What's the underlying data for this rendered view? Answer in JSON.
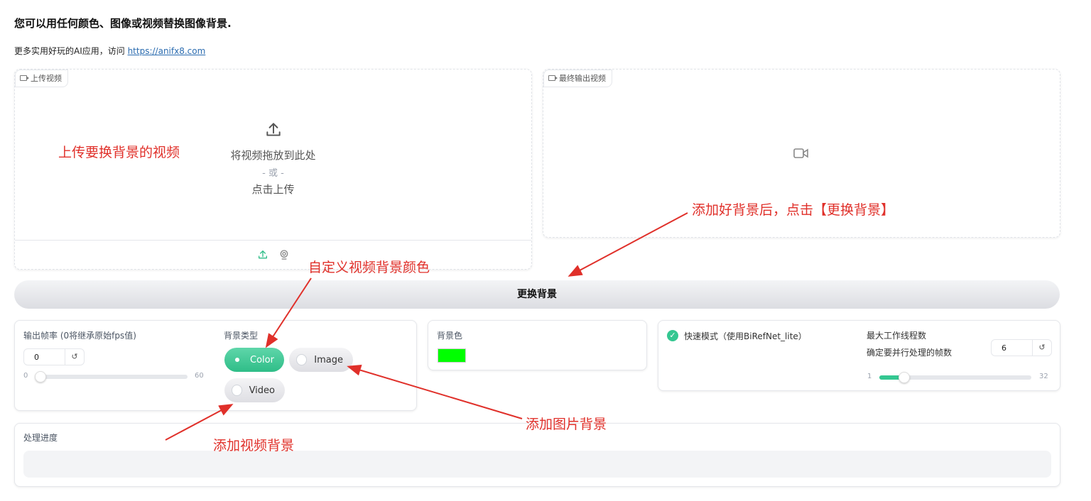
{
  "header": {
    "subtitle": "您可以用任何颜色、图像或视频替换图像背景.",
    "note_prefix": "更多实用好玩的AI应用，访问 ",
    "note_link": "https://anifx8.com"
  },
  "upload_panel": {
    "tag": "上传视频",
    "drop_text": "将视频拖放到此处",
    "or_text": "- 或 -",
    "click_text": "点击上传"
  },
  "output_panel": {
    "tag": "最终输出视频"
  },
  "action_button": "更换背景",
  "fps": {
    "label": "输出帧率 (0将继承原始fps值)",
    "value": "0",
    "reset": "↺",
    "min": "0",
    "max": "60",
    "level": 0
  },
  "bg_type": {
    "label": "背景类型",
    "options": [
      "Color",
      "Image",
      "Video"
    ],
    "selected": "Color"
  },
  "bg_color": {
    "label": "背景色",
    "value": "#00ff00"
  },
  "fast_mode": {
    "label": "快速模式（使用BiRefNet_lite）",
    "checked": true
  },
  "workers": {
    "label": "最大工作线程数",
    "desc": "确定要并行处理的帧数",
    "value": "6",
    "reset": "↺",
    "min": "1",
    "max": "32",
    "level": 0.16
  },
  "progress": {
    "label": "处理进度"
  },
  "annotations": {
    "upload": "上传要换背景的视频",
    "click": "添加好背景后，点击【更换背景】",
    "color": "自定义视频背景颜色",
    "image": "添加图片背景",
    "video": "添加视频背景"
  },
  "colors": {
    "accent": "#34c791",
    "annotation": "#e0302a"
  }
}
